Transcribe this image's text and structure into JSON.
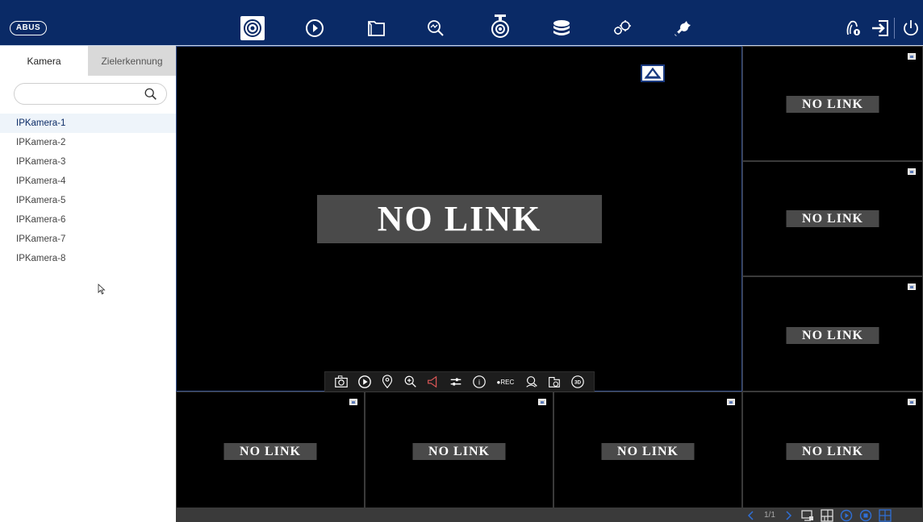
{
  "brand": {
    "logo_text": "ABUS"
  },
  "nav": {
    "items": [
      {
        "name": "live-view-icon",
        "active": true
      },
      {
        "name": "playback-icon",
        "active": false
      },
      {
        "name": "file-folder-icon",
        "active": false
      },
      {
        "name": "smart-search-icon",
        "active": false
      },
      {
        "name": "ptz-camera-icon",
        "active": false
      },
      {
        "name": "storage-icon",
        "active": false
      },
      {
        "name": "settings-icon",
        "active": false
      },
      {
        "name": "maintenance-wrench-icon",
        "active": false
      }
    ],
    "right": [
      "user-lock-icon",
      "logout-icon",
      "power-icon"
    ]
  },
  "sidebar": {
    "tabs": [
      {
        "label": "Kamera",
        "active": true
      },
      {
        "label": "Zielerkennung",
        "active": false
      }
    ],
    "search": {
      "placeholder": "",
      "value": ""
    },
    "cameras": [
      "IPKamera-1",
      "IPKamera-2",
      "IPKamera-3",
      "IPKamera-4",
      "IPKamera-5",
      "IPKamera-6",
      "IPKamera-7",
      "IPKamera-8"
    ],
    "selected_index": 0
  },
  "video": {
    "main_status": "NO LINK",
    "cell_status": "NO LINK",
    "toolbar": {
      "rec_label": "●REC",
      "three_d_label": "3D",
      "info_label": "i"
    }
  },
  "bottom": {
    "page": "1/1"
  },
  "colors": {
    "topbar": "#0a2a66",
    "selected_bg": "#eef4fa",
    "nolink_bg": "#4a4a4a"
  }
}
